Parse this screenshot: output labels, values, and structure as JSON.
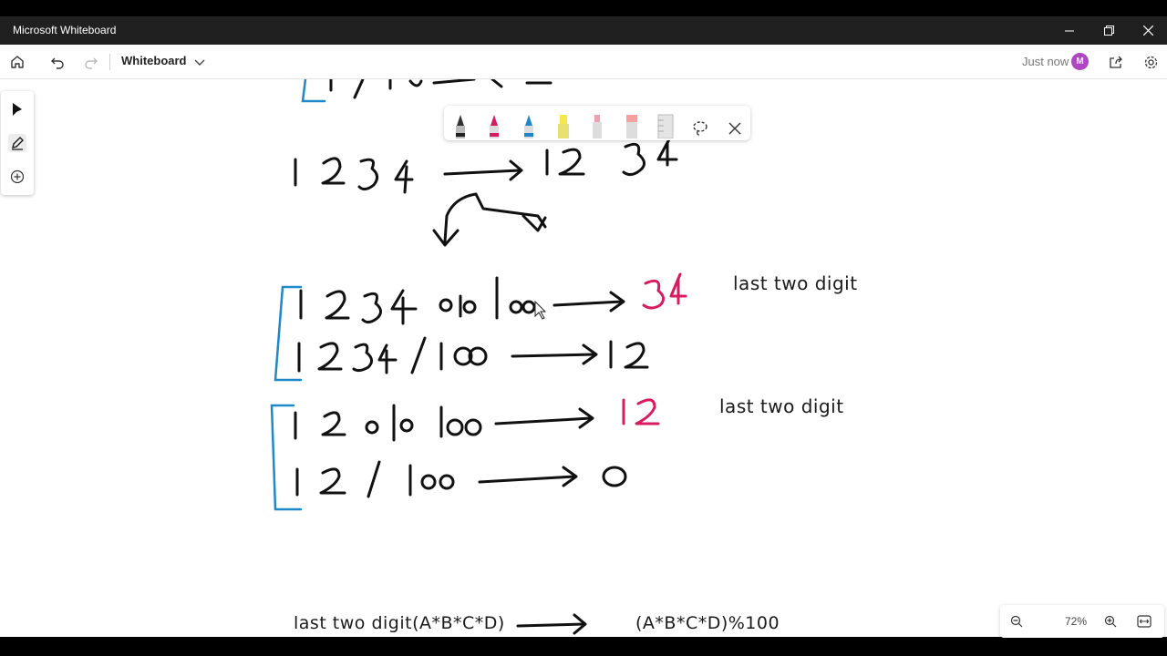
{
  "window": {
    "title": "Microsoft Whiteboard"
  },
  "toolbar": {
    "board_name": "Whiteboard",
    "status": "Just now",
    "avatar_initial": "M"
  },
  "zoom": {
    "level": "72%"
  },
  "notes": {
    "note1": "last two digit",
    "note2": "last two digit",
    "formula_left": "last two digit(A*B*C*D)",
    "formula_right": "(A*B*C*D)%100"
  },
  "colors": {
    "accent": "#b146c2",
    "ink": "#1a1a1a",
    "pink": "#d81b60",
    "blue": "#1e88c8"
  },
  "pens": [
    "black-pen",
    "pink-pen",
    "blue-pen",
    "yellow-highlighter",
    "pencil",
    "eraser",
    "ruler"
  ]
}
